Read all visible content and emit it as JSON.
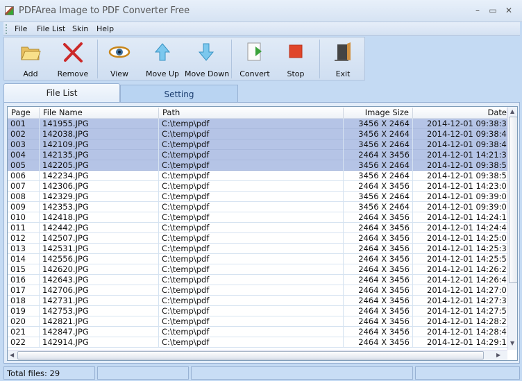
{
  "window": {
    "title": "PDFArea Image to PDF Converter Free",
    "minimize": "–",
    "maximize": "▭",
    "close": "✕"
  },
  "menu": [
    "File",
    "File List",
    "Skin",
    "Help"
  ],
  "toolbar": [
    {
      "label": "Add",
      "icon": "folder-icon"
    },
    {
      "label": "Remove",
      "icon": "red-x-icon"
    },
    {
      "label": "View",
      "icon": "eye-icon"
    },
    {
      "label": "Move Up",
      "icon": "arrow-up-icon"
    },
    {
      "label": "Move Down",
      "icon": "arrow-down-icon"
    },
    {
      "label": "Convert",
      "icon": "convert-icon"
    },
    {
      "label": "Stop",
      "icon": "stop-icon"
    },
    {
      "label": "Exit",
      "icon": "door-exit-icon"
    }
  ],
  "tabs": {
    "file_list": "File List",
    "setting": "Setting"
  },
  "table": {
    "columns": [
      "Page",
      "File Name",
      "Path",
      "Image Size",
      "Date"
    ],
    "rows": [
      [
        "001",
        "141955.JPG",
        "C:\\temp\\pdf",
        "3456 X 2464",
        "2014-12-01 09:38:3"
      ],
      [
        "002",
        "142038.JPG",
        "C:\\temp\\pdf",
        "3456 X 2464",
        "2014-12-01 09:38:4"
      ],
      [
        "003",
        "142109.JPG",
        "C:\\temp\\pdf",
        "3456 X 2464",
        "2014-12-01 09:38:4"
      ],
      [
        "004",
        "142135.JPG",
        "C:\\temp\\pdf",
        "2464 X 3456",
        "2014-12-01 14:21:3"
      ],
      [
        "005",
        "142205.JPG",
        "C:\\temp\\pdf",
        "3456 X 2464",
        "2014-12-01 09:38:5"
      ],
      [
        "006",
        "142234.JPG",
        "C:\\temp\\pdf",
        "3456 X 2464",
        "2014-12-01 09:38:5"
      ],
      [
        "007",
        "142306.JPG",
        "C:\\temp\\pdf",
        "2464 X 3456",
        "2014-12-01 14:23:0"
      ],
      [
        "008",
        "142329.JPG",
        "C:\\temp\\pdf",
        "3456 X 2464",
        "2014-12-01 09:39:0"
      ],
      [
        "009",
        "142353.JPG",
        "C:\\temp\\pdf",
        "3456 X 2464",
        "2014-12-01 09:39:0"
      ],
      [
        "010",
        "142418.JPG",
        "C:\\temp\\pdf",
        "2464 X 3456",
        "2014-12-01 14:24:1"
      ],
      [
        "011",
        "142442.JPG",
        "C:\\temp\\pdf",
        "2464 X 3456",
        "2014-12-01 14:24:4"
      ],
      [
        "012",
        "142507.JPG",
        "C:\\temp\\pdf",
        "2464 X 3456",
        "2014-12-01 14:25:0"
      ],
      [
        "013",
        "142531.JPG",
        "C:\\temp\\pdf",
        "2464 X 3456",
        "2014-12-01 14:25:3"
      ],
      [
        "014",
        "142556.JPG",
        "C:\\temp\\pdf",
        "2464 X 3456",
        "2014-12-01 14:25:5"
      ],
      [
        "015",
        "142620.JPG",
        "C:\\temp\\pdf",
        "2464 X 3456",
        "2014-12-01 14:26:2"
      ],
      [
        "016",
        "142643.JPG",
        "C:\\temp\\pdf",
        "2464 X 3456",
        "2014-12-01 14:26:4"
      ],
      [
        "017",
        "142706.JPG",
        "C:\\temp\\pdf",
        "2464 X 3456",
        "2014-12-01 14:27:0"
      ],
      [
        "018",
        "142731.JPG",
        "C:\\temp\\pdf",
        "2464 X 3456",
        "2014-12-01 14:27:3"
      ],
      [
        "019",
        "142753.JPG",
        "C:\\temp\\pdf",
        "2464 X 3456",
        "2014-12-01 14:27:5"
      ],
      [
        "020",
        "142821.JPG",
        "C:\\temp\\pdf",
        "2464 X 3456",
        "2014-12-01 14:28:2"
      ],
      [
        "021",
        "142847.JPG",
        "C:\\temp\\pdf",
        "2464 X 3456",
        "2014-12-01 14:28:4"
      ],
      [
        "022",
        "142914.JPG",
        "C:\\temp\\pdf",
        "2464 X 3456",
        "2014-12-01 14:29:1"
      ]
    ],
    "selected_rows": [
      0,
      1,
      2,
      3,
      4
    ],
    "selection_color": "#b5c4e6"
  },
  "status": {
    "total": "Total files: 29"
  }
}
